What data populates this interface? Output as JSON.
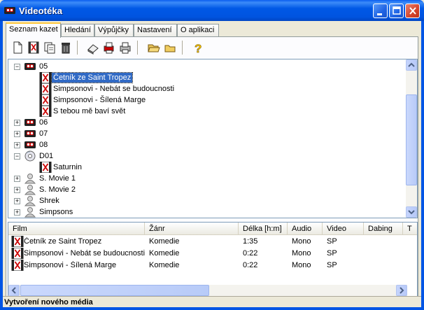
{
  "window": {
    "title": "Videotéka",
    "accent": "#0055e5"
  },
  "tabs": [
    {
      "label": "Seznam kazet",
      "active": true
    },
    {
      "label": "Hledání"
    },
    {
      "label": "Výpůjčky"
    },
    {
      "label": "Nastavení"
    },
    {
      "label": "O aplikaci"
    }
  ],
  "toolbar": {
    "icons": [
      "new-document-icon",
      "new-film-icon",
      "copy-icon",
      "delete-trash-icon",
      "eraser-icon",
      "print-preview-icon",
      "print-icon",
      "open-folder-icon",
      "folder-icon",
      "help-icon"
    ]
  },
  "tree": {
    "nodes": [
      {
        "label": "05",
        "icon": "cassette-icon",
        "level": 0,
        "expander": "−"
      },
      {
        "label": "Četník ze Saint Tropez",
        "icon": "film-icon",
        "level": 1,
        "selected": true
      },
      {
        "label": "Simpsonovi - Nebát se budoucnosti",
        "icon": "film-icon",
        "level": 1
      },
      {
        "label": "Simpsonovi - Šílená Marge",
        "icon": "film-icon",
        "level": 1
      },
      {
        "label": "S tebou mě baví svět",
        "icon": "film-icon",
        "level": 1
      },
      {
        "label": "06",
        "icon": "cassette-icon",
        "level": 0,
        "expander": "+"
      },
      {
        "label": "07",
        "icon": "cassette-icon",
        "level": 0,
        "expander": "+"
      },
      {
        "label": "08",
        "icon": "cassette-icon",
        "level": 0,
        "expander": "+"
      },
      {
        "label": "D01",
        "icon": "dvd-icon",
        "level": 0,
        "expander": "−"
      },
      {
        "label": "Saturnin",
        "icon": "film-icon",
        "level": 1
      },
      {
        "label": "S. Movie 1",
        "icon": "person-icon",
        "level": 0,
        "expander": "+"
      },
      {
        "label": "S. Movie 2",
        "icon": "person-icon",
        "level": 0,
        "expander": "+"
      },
      {
        "label": "Shrek",
        "icon": "person-icon",
        "level": 0,
        "expander": "+"
      },
      {
        "label": "Simpsons",
        "icon": "person-icon",
        "level": 0,
        "expander": "+"
      }
    ]
  },
  "list": {
    "columns": [
      "Film",
      "Žánr",
      "Délka [h:m]",
      "Audio",
      "Video",
      "Dabing",
      "T"
    ],
    "rows": [
      [
        "Četník ze Saint Tropez",
        "Komedie",
        "1:35",
        "Mono",
        "SP"
      ],
      [
        "Simpsonovi - Nebát se budoucnosti",
        "Komedie",
        "0:22",
        "Mono",
        "SP"
      ],
      [
        "Simpsonovi - Šílená Marge",
        "Komedie",
        "0:22",
        "Mono",
        "SP"
      ]
    ]
  },
  "status": {
    "text": "Vytvoření nového média"
  }
}
